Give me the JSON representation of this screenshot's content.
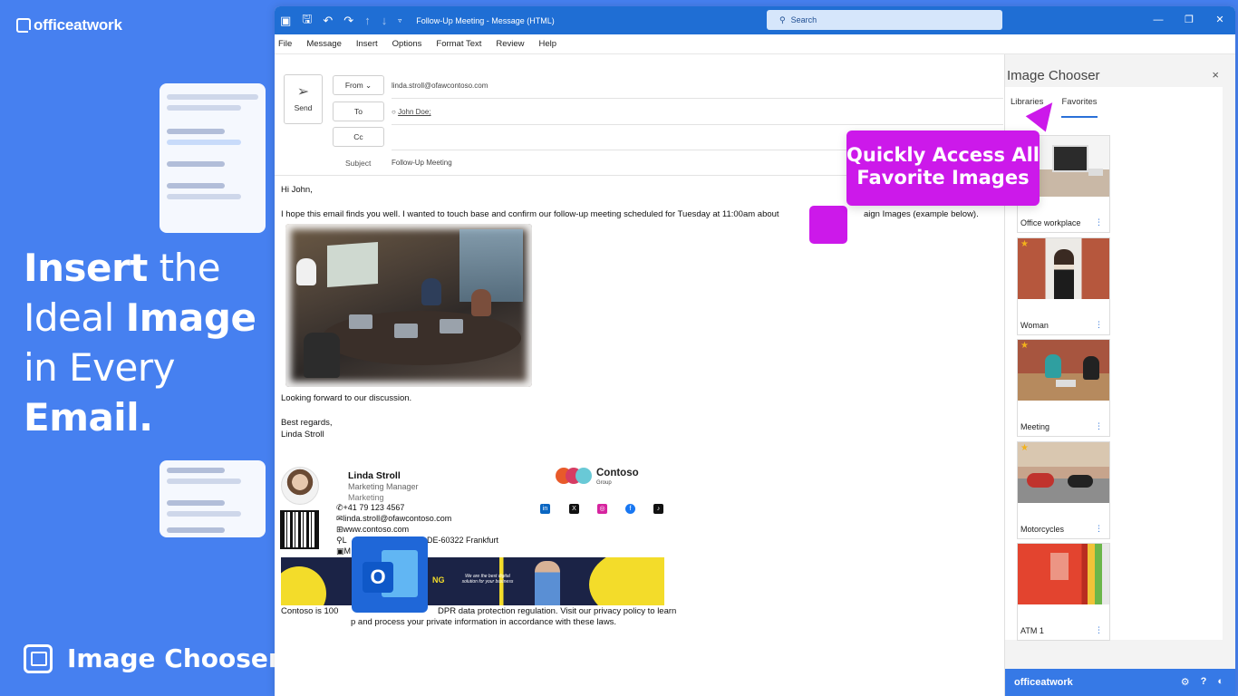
{
  "brand": {
    "name": "officeatwork"
  },
  "headline": {
    "w1": "Insert",
    "w2": "the",
    "w3": "Ideal",
    "w4": "Image",
    "w5": "in Every",
    "w6": "Email."
  },
  "footer_brand": {
    "label": "Image Chooser",
    "icon": "image-chooser-icon"
  },
  "window": {
    "title": "Follow-Up Meeting  -  Message (HTML)",
    "search_placeholder": "Search",
    "menu": [
      "File",
      "Message",
      "Insert",
      "Options",
      "Format Text",
      "Review",
      "Help"
    ]
  },
  "compose": {
    "send_label": "Send",
    "from_label": "From",
    "to_label": "To",
    "cc_label": "Cc",
    "subject_label": "Subject",
    "from_value": "linda.stroll@ofawcontoso.com",
    "to_value": "John Doe;",
    "subject_value": "Follow-Up Meeting",
    "greeting": "Hi John,",
    "paragraph": "I hope this email finds you well. I wanted to touch base and confirm our follow-up meeting scheduled for Tuesday at 11:00am about",
    "paragraph_tail": "aign Images (example below).",
    "closing": "Looking forward to our discussion.",
    "regards": "Best regards,",
    "signoff": "Linda Stroll"
  },
  "signature": {
    "name": "Linda Stroll",
    "role": "Marketing Manager",
    "department": "Marketing",
    "phone": "+41 79 123 4567",
    "email": "linda.stroll@ofawcontoso.com",
    "web": "www.contoso.com",
    "address_start": "L",
    "address_end": "DE-60322 Frankfurt",
    "line4": "M",
    "company": "Contoso",
    "company_sub": "Group",
    "banner_text": "We are the best digital solution for your business",
    "banner_g": "NG",
    "disclaimer_1a": "Contoso is 100",
    "disclaimer_1b": "DPR data protection regulation. Visit our privacy policy to learn",
    "disclaimer_2": "p and process your private information in accordance with these laws.",
    "social": [
      "linkedin-icon",
      "x-icon",
      "instagram-icon",
      "facebook-icon",
      "tiktok-icon"
    ]
  },
  "panel": {
    "title": "Image Chooser",
    "tabs": [
      "Libraries",
      "Favorites"
    ],
    "active_tab": "Favorites",
    "cards": [
      {
        "label": "Office workplace",
        "starred": false
      },
      {
        "label": "Woman",
        "starred": true
      },
      {
        "label": "Meeting",
        "starred": true
      },
      {
        "label": "Motorcycles",
        "starred": true
      },
      {
        "label": "ATM 1",
        "starred": false
      }
    ],
    "footer_brand": "officeatwork"
  },
  "callout": {
    "line1": "Quickly Access All",
    "line2": "Favorite Images"
  },
  "colors": {
    "background": "#4680f0",
    "titlebar": "#1f6ed4",
    "callout": "#cc19ea",
    "accent": "#2a70d8"
  }
}
